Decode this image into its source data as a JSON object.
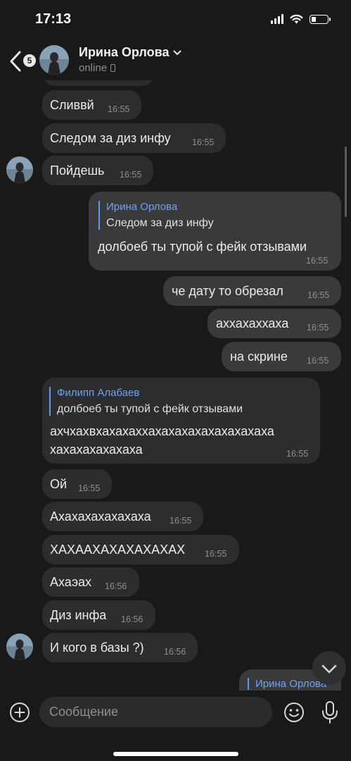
{
  "status_bar": {
    "time": "17:13",
    "battery_level": 0.3
  },
  "header": {
    "back_badge": "5",
    "name": "Ирина Орлова",
    "status": "online",
    "icons": [
      "chevron-left-icon",
      "chevron-down-icon",
      "phone-icon"
    ]
  },
  "messages": [
    {
      "text": "Сливвй",
      "time": "16:55"
    },
    {
      "text": "Следом за диз инфу",
      "time": "16:55"
    },
    {
      "text": "Пойдешь",
      "time": "16:55"
    },
    {
      "reply_name": "Ирина Орлова",
      "reply_text": "Следом за диз инфу",
      "text": "долбоеб ты тупой с фейк отзывами",
      "time": "16:55"
    },
    {
      "text": "че дату то обрезал",
      "time": "16:55"
    },
    {
      "text": "аххахаххаха",
      "time": "16:55"
    },
    {
      "text": "на скрине",
      "time": "16:55"
    },
    {
      "reply_name": "Филипп Алабаев",
      "reply_text": "долбоеб ты тупой с фейк отзывами",
      "text_line1": "ахчхахвхахахаххахахахахахахахахаха",
      "text_line2": "хахахахахахаха",
      "time": "16:55"
    },
    {
      "text": "Ой",
      "time": "16:55"
    },
    {
      "text": "Ахахахахахахаха",
      "time": "16:55"
    },
    {
      "text": "ХАХААХАХАХАХАХАХ",
      "time": "16:55"
    },
    {
      "text": "Ахаэах",
      "time": "16:56"
    },
    {
      "text": "Диз инфа",
      "time": "16:56"
    },
    {
      "text": "И кого в базы ?)",
      "time": "16:56"
    },
    {
      "reply_name": "Ирина Орлова"
    }
  ],
  "composer": {
    "placeholder": "Сообщение",
    "icons": [
      "plus-icon",
      "emoji-icon",
      "microphone-icon"
    ]
  },
  "colors": {
    "background": "#19191a",
    "bubble_in": "#2d2d30",
    "bubble_out": "#3a3a3d",
    "reply_accent": "#5b9cf0",
    "time": "#8e8e93"
  }
}
